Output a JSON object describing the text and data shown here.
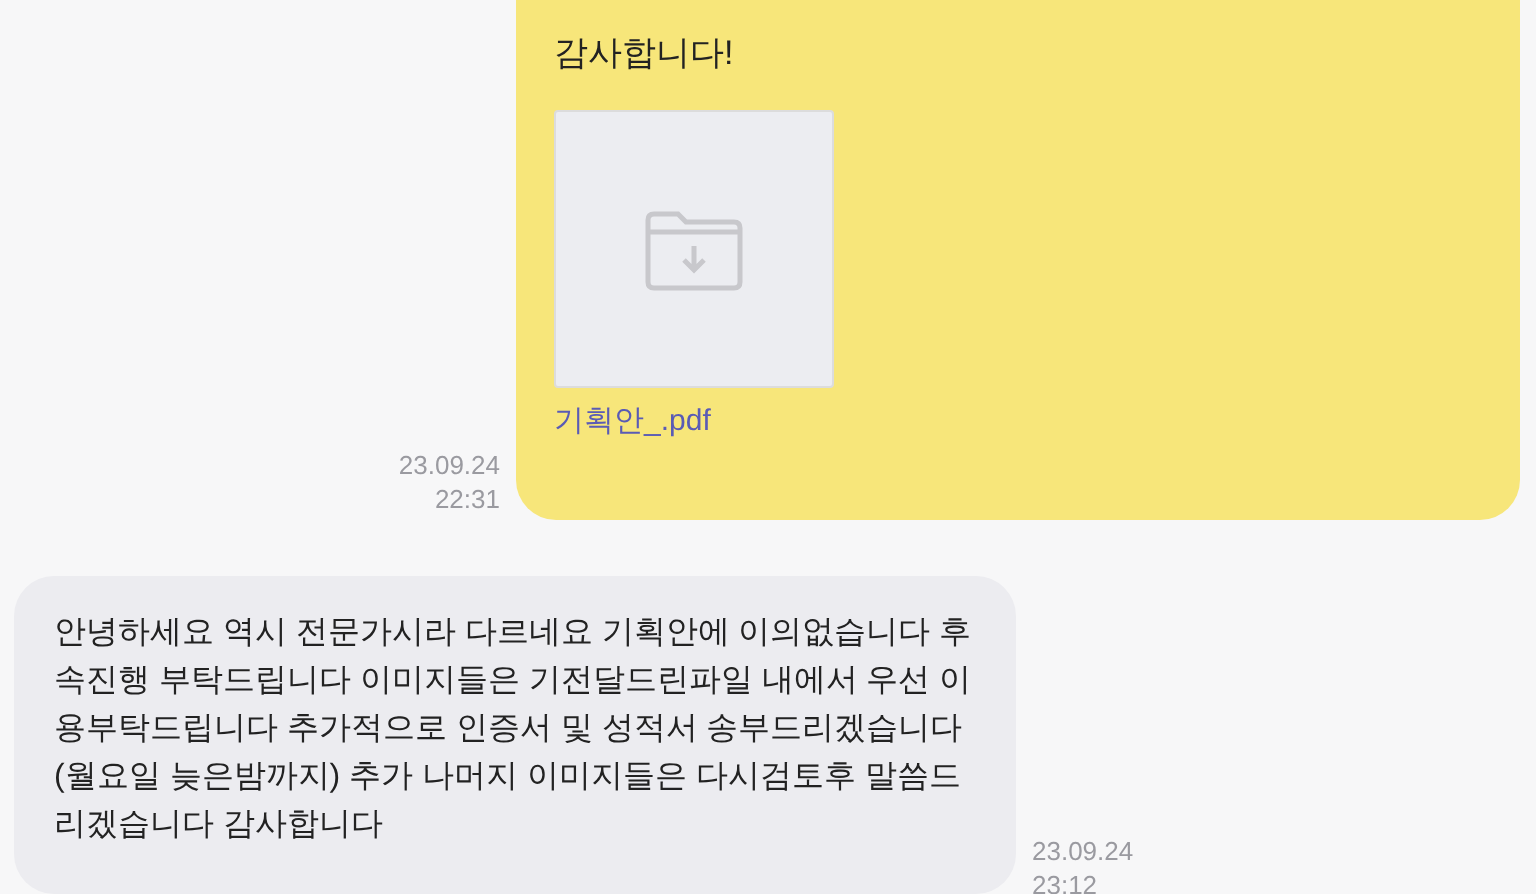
{
  "messages": [
    {
      "kind": "sent",
      "text": "감사합니다!",
      "attachment": {
        "filename": "기획안_.pdf"
      },
      "date": "23.09.24",
      "time": "22:31"
    },
    {
      "kind": "received",
      "text": "안녕하세요 역시 전문가시라 다르네요 기획안에 이의없습니다 후속진행 부탁드립니다 이미지들은 기전달드린파일 내에서 우선 이용부탁드립니다 추가적으로 인증서 및 성적서 송부드리겠습니다 (월요일 늦은밤까지) 추가 나머지 이미지들은 다시검토후 말씀드리겠습니다 감사합니다",
      "date": "23.09.24",
      "time": "23:12"
    }
  ]
}
